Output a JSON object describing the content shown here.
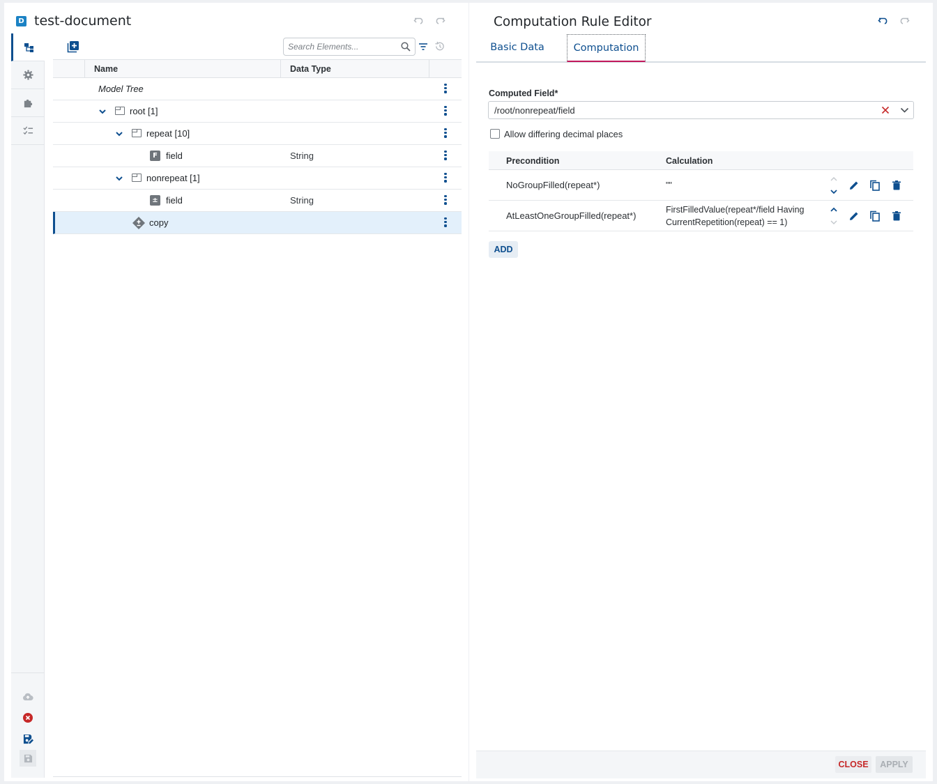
{
  "document": {
    "badge": "D",
    "title": "test-document"
  },
  "sidebar": {
    "items": [
      {
        "name": "model-tree",
        "icon": "tree-icon"
      },
      {
        "name": "settings",
        "icon": "gear-icon"
      },
      {
        "name": "plugins",
        "icon": "puzzle-icon"
      },
      {
        "name": "checklist",
        "icon": "checklist-icon"
      }
    ],
    "bottom": [
      {
        "name": "upload",
        "icon": "cloud-upload-icon"
      },
      {
        "name": "discard",
        "icon": "error-circle-icon"
      },
      {
        "name": "save-as",
        "icon": "save-edit-icon"
      },
      {
        "name": "save",
        "icon": "save-icon"
      }
    ]
  },
  "toolbar": {
    "search_placeholder": "Search Elements..."
  },
  "tree": {
    "columns": [
      "Name",
      "Data Type"
    ],
    "rows": [
      {
        "label": "Model Tree",
        "type": ""
      },
      {
        "label": "root [1]",
        "type": ""
      },
      {
        "label": "repeat [10]",
        "type": ""
      },
      {
        "label": "field",
        "type": "String",
        "icon_text": "F"
      },
      {
        "label": "nonrepeat [1]",
        "type": ""
      },
      {
        "label": "field",
        "type": "String",
        "icon_text": "±"
      },
      {
        "label": "copy",
        "type": ""
      }
    ]
  },
  "editor": {
    "title": "Computation Rule Editor",
    "tabs": [
      "Basic Data",
      "Computation"
    ],
    "active_tab": "Computation",
    "computed_field_label": "Computed Field*",
    "computed_field_value": "/root/nonrepeat/field",
    "checkbox_label": "Allow differing decimal places",
    "rules_columns": [
      "Precondition",
      "Calculation"
    ],
    "rules": [
      {
        "precondition": "NoGroupFilled(repeat*)",
        "calculation": "\"\""
      },
      {
        "precondition": "AtLeastOneGroupFilled(repeat*)",
        "calculation": "FirstFilledValue(repeat*/field Having CurrentRepetition(repeat) == 1)"
      }
    ],
    "add_label": "ADD",
    "close_label": "CLOSE",
    "apply_label": "APPLY"
  },
  "colors": {
    "accent": "#0e4f8f",
    "tab_underline": "#c2185b",
    "danger": "#c62828",
    "selection": "#e3f0fb"
  }
}
